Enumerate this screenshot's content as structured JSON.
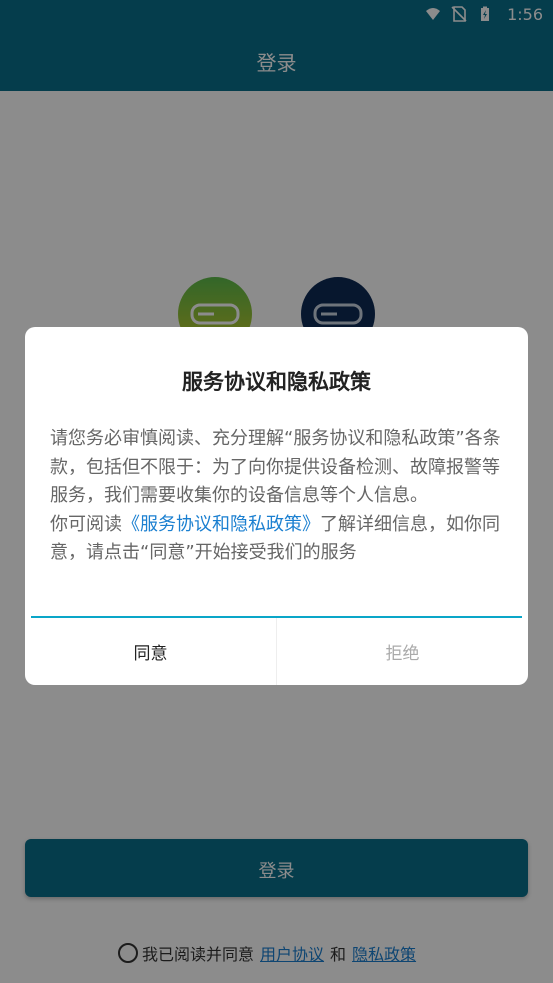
{
  "status_bar": {
    "time": "1:56"
  },
  "header": {
    "title": "登录"
  },
  "login": {
    "button_label": "登录",
    "agree_prefix": "我已阅读并同意",
    "user_agreement": "用户协议",
    "and": "和",
    "privacy_policy": "隐私政策"
  },
  "dialog": {
    "title": "服务协议和隐私政策",
    "paragraph1": "请您务必审慎阅读、充分理解“服务协议和隐私政策”各条款，包括但不限于：为了向你提供设备检测、故障报警等服务，我们需要收集你的设备信息等个人信息。",
    "paragraph2_prefix": "你可阅读",
    "paragraph2_link": "《服务协议和隐私政策》",
    "paragraph2_suffix": "了解详细信息，如你同意，请点击“同意”开始接受我们的服务",
    "agree_label": "同意",
    "reject_label": "拒绝"
  },
  "colors": {
    "primary": "#0a6f8a",
    "link": "#1a7fd0",
    "divider": "#0aa6c8"
  }
}
